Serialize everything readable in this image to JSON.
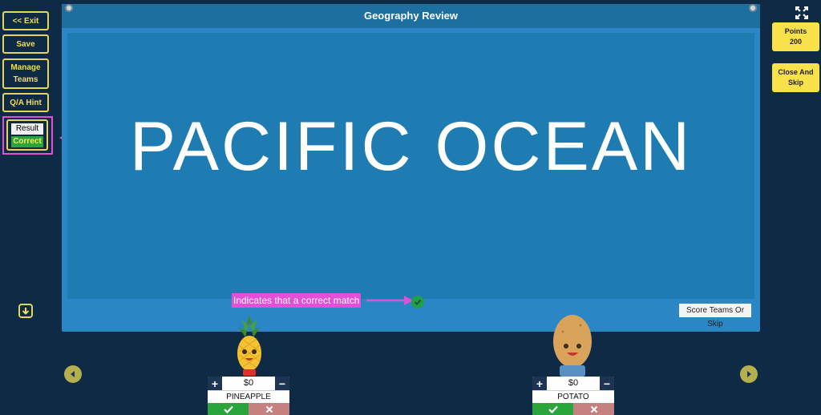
{
  "left_toolbar": {
    "exit_label": "<< Exit",
    "save_label": "Save",
    "manage_teams_label": "Manage Teams",
    "qa_hint_label": "Q/A Hint",
    "result_label": "Result",
    "correct_label": "Correct"
  },
  "board": {
    "title": "Geography Review",
    "answer": "PACIFIC OCEAN",
    "annotation": "Indicates that a correct match",
    "score_skip_label": "Score Teams Or Skip"
  },
  "right_panel": {
    "points_label": "Points",
    "points_value": "200",
    "close_skip_label": "Close And Skip"
  },
  "teams": [
    {
      "name": "PINEAPPLE",
      "score": "$0"
    },
    {
      "name": "POTATO",
      "score": "$0"
    }
  ],
  "icons": {
    "expand": "expand-icon",
    "down": "arrow-down-icon",
    "prev": "chevron-left-icon",
    "next": "chevron-right-icon"
  },
  "colors": {
    "accent_yellow": "#f9e14a",
    "annotation_pink": "#e34fd8",
    "correct_green": "#2aa53c",
    "board_blue": "#2b86c5",
    "background": "#0f2a45"
  }
}
